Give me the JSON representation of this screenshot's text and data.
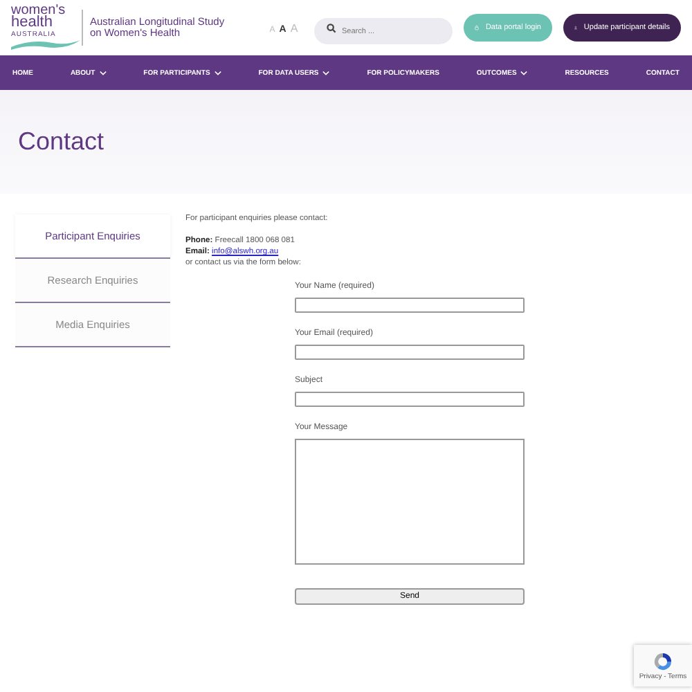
{
  "logo": {
    "line_1": "women's",
    "line_2": "health",
    "line_3": "AUSTRALIA"
  },
  "tagline": {
    "line_1": "Australian Longitudinal Study",
    "line_2": "on Women's Health"
  },
  "font_sizes": [
    {
      "label": "A",
      "selected": false
    },
    {
      "label": "A",
      "selected": true
    },
    {
      "label": "A",
      "selected": false
    }
  ],
  "search": {
    "placeholder": "Search ..."
  },
  "header_buttons": [
    {
      "label": "Data portal login",
      "kind": "lock"
    },
    {
      "label": "Update participant details",
      "kind": "person"
    }
  ],
  "nav": [
    {
      "label": "HOME",
      "dropdown": false
    },
    {
      "label": "ABOUT",
      "dropdown": true
    },
    {
      "label": "FOR PARTICIPANTS",
      "dropdown": true
    },
    {
      "label": "FOR DATA USERS",
      "dropdown": true
    },
    {
      "label": "FOR POLICYMAKERS",
      "dropdown": false
    },
    {
      "label": "OUTCOMES",
      "dropdown": true
    },
    {
      "label": "RESOURCES",
      "dropdown": false
    },
    {
      "label": "CONTACT",
      "dropdown": false
    }
  ],
  "page_title": "Contact",
  "tabs": [
    {
      "label": "Participant Enquiries",
      "selected": true
    },
    {
      "label": "Research Enquiries",
      "selected": false
    },
    {
      "label": "Media Enquiries",
      "selected": false
    }
  ],
  "intro": "For participant enquiries please contact:",
  "phone": {
    "label": "Phone:",
    "value": "Freecall 1800 068 081"
  },
  "email": {
    "label": "Email:",
    "value": "info@alswh.org.au"
  },
  "outro": "or contact us via the form below:",
  "form": {
    "fields": [
      {
        "label": "Your Name (required)",
        "kind": "input"
      },
      {
        "label": "Your Email (required)",
        "kind": "input"
      },
      {
        "label": "Subject",
        "kind": "input"
      },
      {
        "label": "Your Message",
        "kind": "textarea"
      }
    ],
    "submit": "Send"
  },
  "recaptcha": {
    "text": "Privacy - Terms"
  }
}
